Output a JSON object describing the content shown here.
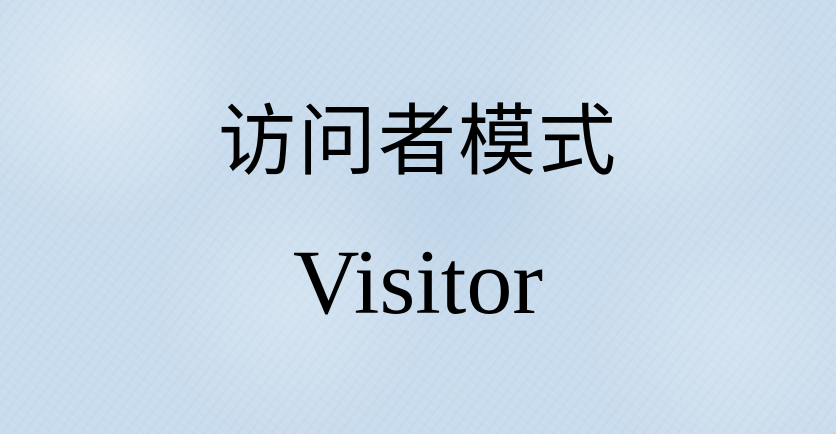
{
  "slide": {
    "title_cn": "访问者模式",
    "title_en": "Visitor"
  },
  "colors": {
    "background": "#c9dced",
    "text": "#000000"
  }
}
